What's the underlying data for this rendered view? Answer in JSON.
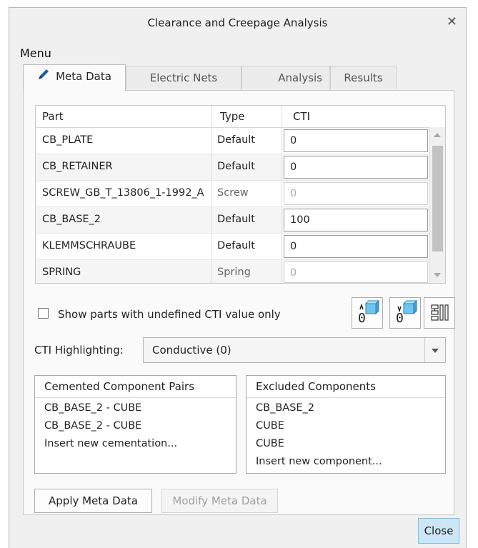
{
  "window": {
    "title": "Clearance and Creepage Analysis",
    "close_glyph": "✕"
  },
  "menu": {
    "label": "Menu"
  },
  "tabs": [
    {
      "label": "Meta Data",
      "icon": "pencil-icon",
      "active": true
    },
    {
      "label": "Electric Nets",
      "active": false
    },
    {
      "label": "Analysis",
      "active": false
    },
    {
      "label": "Results",
      "active": false
    }
  ],
  "table": {
    "columns": [
      "Part",
      "Type",
      "CTI"
    ],
    "rows": [
      {
        "part": "CB_PLATE",
        "type": "Default",
        "cti": "0",
        "editable": true
      },
      {
        "part": "CB_RETAINER",
        "type": "Default",
        "cti": "0",
        "editable": true
      },
      {
        "part": "SCREW_GB_T_13806_1-1992_A",
        "type": "Screw",
        "cti": "0",
        "editable": false
      },
      {
        "part": "CB_BASE_2",
        "type": "Default",
        "cti": "100",
        "editable": true
      },
      {
        "part": "KLEMMSCHRAUBE",
        "type": "Default",
        "cti": "0",
        "editable": true
      },
      {
        "part": "SPRING",
        "type": "Spring",
        "cti": "0",
        "editable": false
      }
    ]
  },
  "filter": {
    "checkbox_label": "Show parts with undefined CTI value only",
    "checked": false
  },
  "cti_highlighting": {
    "label": "CTI Highlighting:",
    "value": "Conductive (0)"
  },
  "cemented": {
    "header": "Cemented Component Pairs",
    "items": [
      "CB_BASE_2 - CUBE",
      "CB_BASE_2 - CUBE",
      "Insert new cementation..."
    ]
  },
  "excluded": {
    "header": "Excluded Components",
    "items": [
      "CB_BASE_2",
      "CUBE",
      "CUBE",
      "Insert new component..."
    ]
  },
  "buttons": {
    "apply": "Apply Meta Data",
    "modify": "Modify Meta Data",
    "close": "Close"
  },
  "colors": {
    "accent_cube": "#6ec6f0",
    "close_button_bg": "#cce6f5",
    "close_button_border": "#7fbfe3"
  }
}
